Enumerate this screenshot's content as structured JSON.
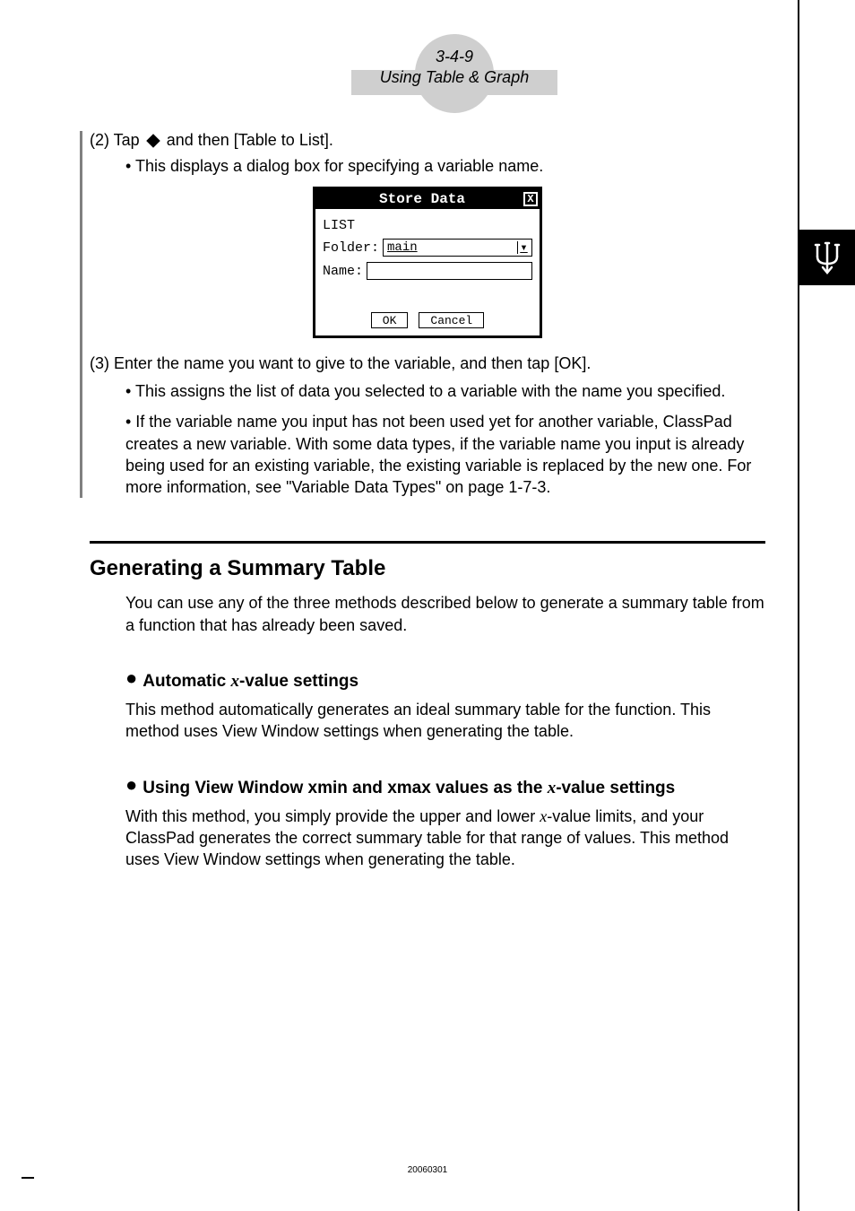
{
  "header": {
    "page_num": "3-4-9",
    "section_title": "Using Table & Graph"
  },
  "step2": {
    "prefix": "(2) Tap",
    "suffix": "and then [Table to List].",
    "bullet": "• This displays a dialog box for specifying a variable name."
  },
  "dialog": {
    "title": "Store Data",
    "type_label": "LIST",
    "folder_label": "Folder:",
    "folder_value": "main",
    "name_label": "Name:",
    "name_value": "",
    "ok": "OK",
    "cancel": "Cancel"
  },
  "step3": {
    "line": "(3) Enter the name you want to give to the variable, and then tap [OK].",
    "bullet1": "• This assigns the list of data you selected to a variable with the name you specified.",
    "bullet2": "• If the variable name you input has not been used yet for another variable, ClassPad creates a new variable. With some data types, if the variable name you input is already being used for an existing variable, the existing variable is replaced by the new one. For more information, see \"Variable Data Types\" on page 1-7-3."
  },
  "section": {
    "heading": "Generating a Summary Table",
    "intro": "You can use any of the three methods described below to generate a summary table from a function that has already been saved."
  },
  "sub1": {
    "title_pre": "Automatic ",
    "title_x": "x",
    "title_post": "-value settings",
    "body": "This method automatically generates an ideal summary table for the function.  This method uses View Window settings when generating the table."
  },
  "sub2": {
    "title_pre": "Using View Window xmin and xmax values as the ",
    "title_x": "x",
    "title_post": "-value settings",
    "body_pre": "With this method, you simply provide the upper and lower ",
    "body_x": "x",
    "body_post": "-value limits, and your ClassPad generates the correct summary table for that range of values. This method uses View Window settings when generating the table."
  },
  "footer": "20060301"
}
